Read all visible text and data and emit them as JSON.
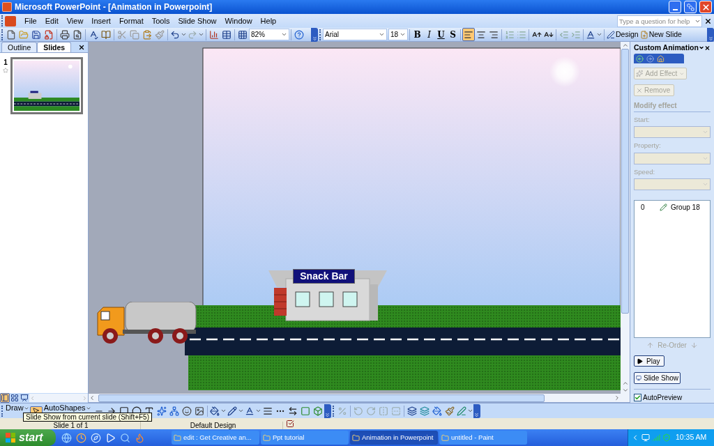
{
  "window": {
    "title": "Microsoft PowerPoint - [Animation in Powerpoint]"
  },
  "menu": [
    "File",
    "Edit",
    "View",
    "Insert",
    "Format",
    "Tools",
    "Slide Show",
    "Window",
    "Help"
  ],
  "help_box": {
    "placeholder": "Type a question for help"
  },
  "standard_toolbar": {
    "zoom": "82%"
  },
  "formatting_toolbar": {
    "font": "Arial",
    "size": "18",
    "style_buttons": [
      "B",
      "I",
      "U",
      "S"
    ],
    "alignment": [
      {
        "selected": true
      },
      {
        "selected": false
      },
      {
        "selected": false
      }
    ],
    "design": "Design",
    "new_slide": "New Slide"
  },
  "slides_pane": {
    "tabs": [
      {
        "label": "Outline",
        "selected": false
      },
      {
        "label": "Slides",
        "selected": true
      }
    ],
    "thumbnails": [
      {
        "number": "1",
        "selected": true
      }
    ]
  },
  "slide": {
    "sign": "Snack Bar"
  },
  "task_pane": {
    "title": "Custom Animation",
    "add_effect": {
      "label": "Add Effect",
      "disabled": true
    },
    "remove": {
      "label": "Remove",
      "disabled": true
    },
    "section": "Modify effect",
    "fields": [
      {
        "label": "Start:",
        "disabled": true
      },
      {
        "label": "Property:",
        "disabled": true
      },
      {
        "label": "Speed:",
        "disabled": true
      }
    ],
    "effects": [
      {
        "order": "0",
        "name": "Group 18"
      }
    ],
    "reorder": {
      "label": "Re-Order",
      "disabled": true
    },
    "play": "Play",
    "slide_show": "Slide Show",
    "autopreview": {
      "label": "AutoPreview",
      "checked": true
    }
  },
  "drawing_toolbar": {
    "draw": "Draw",
    "autoshapes": "AutoShapes",
    "pointer": {
      "selected": true
    }
  },
  "tooltip": "Slide Show from current slide (Shift+F5)",
  "status_bar": [
    "Slide 1 of 1",
    "Default Design"
  ],
  "taskbar": {
    "start": "start",
    "tasks": [
      {
        "label": "edit : Get Creative an...",
        "selected": false
      },
      {
        "label": "Ppt tutorial",
        "selected": false
      },
      {
        "label": "Animation in Powerpoint",
        "selected": true
      },
      {
        "label": "untitled - Paint",
        "selected": false
      }
    ],
    "clock": "10:35 AM"
  }
}
